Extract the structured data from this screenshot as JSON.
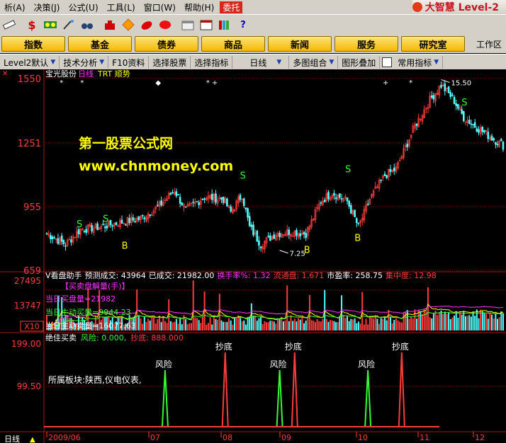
{
  "menu": {
    "items": [
      "析(A)",
      "决策(J)",
      "公式(U)",
      "工具(L)",
      "窗口(W)",
      "帮助(H)"
    ],
    "active": "委托",
    "brand": "大智慧 Level-2"
  },
  "toolbar": {
    "icons": [
      "ruler-icon",
      "dollar-icon",
      "tape-icon",
      "wand-icon",
      "binoculars-icon",
      "alarm-icon",
      "diamond-icon",
      "chili-icon",
      "candy-icon",
      "calendar-icon",
      "window-icon",
      "books-icon",
      "help-icon"
    ]
  },
  "nav": {
    "buttons": [
      "指数",
      "基金",
      "债券",
      "商品",
      "新闻",
      "服务",
      "研究室"
    ],
    "work_area": "工作区"
  },
  "subbar": {
    "items": [
      "Level2默认",
      "技术分析",
      "F10资料",
      "选择股票",
      "选择指标",
      "日线",
      "多图组合",
      "图形叠加",
      "常用指标"
    ],
    "with_arrow": [
      true,
      true,
      false,
      false,
      false,
      true,
      true,
      false,
      true
    ]
  },
  "colors": {
    "up": "#ff3c3c",
    "down": "#54ffff",
    "yellow": "#ffff00",
    "green": "#33ff33",
    "magenta": "#ff33ff",
    "grid": "#800000"
  },
  "main_panel": {
    "stock": "宝光股份",
    "period": "日线",
    "indicator": "TRT 顺势",
    "y_ticks": [
      "1550",
      "1251",
      "955",
      "659"
    ],
    "high_label": "15.50",
    "low_label": "7.25",
    "signals": [
      {
        "t": "S",
        "i": 17,
        "p": 860
      },
      {
        "t": "S",
        "i": 31,
        "p": 885
      },
      {
        "t": "B",
        "i": 41,
        "p": 760
      },
      {
        "t": "S",
        "i": 104,
        "p": 1085
      },
      {
        "t": "B",
        "i": 138,
        "p": 740
      },
      {
        "t": "S",
        "i": 160,
        "p": 1115
      },
      {
        "t": "B",
        "i": 165,
        "p": 795
      },
      {
        "t": "S",
        "i": 222,
        "p": 1425
      }
    ]
  },
  "volume_panel": {
    "title": "V看盘助手",
    "metrics_pred": "预测成交: 43964",
    "metrics_done": "已成交: 21982.00",
    "metrics_turnover": "换手率%: 1.32",
    "metrics_float": "流通盘: 1.671",
    "metrics_pe": "市盈率: 258.75",
    "metrics_conc": "集中度: 12.98",
    "sub_title": "【买卖盘解量(手)】",
    "line1": "当日买盘量=21982",
    "line2": "当日主动买量=9944.23",
    "line3": "当日主动卖量=16077.63",
    "y_ticks": [
      "27495",
      "13747"
    ],
    "unit": "X10"
  },
  "signal_panel": {
    "title": "绝佳买卖",
    "risk_value": "风险: 0.000,",
    "bottom_value": "抄底: 888.000",
    "y_ticks": [
      "199.00",
      "99.50"
    ],
    "sector": "所属板块:陕西,仪电仪表,",
    "risk_label": "风险",
    "bottom_label": "抄底",
    "events": [
      {
        "t": "risk",
        "i": 63
      },
      {
        "t": "bottom",
        "i": 95
      },
      {
        "t": "risk",
        "i": 124
      },
      {
        "t": "bottom",
        "i": 132
      },
      {
        "t": "risk",
        "i": 171
      },
      {
        "t": "bottom",
        "i": 189
      }
    ]
  },
  "x_axis": {
    "labels": [
      "2009/06",
      "07",
      "08",
      "09",
      "10",
      "11",
      "12"
    ]
  },
  "status": {
    "period": "日线"
  },
  "watermark": {
    "line1": "第一股票公式网",
    "line2": "www.chnmoney.com"
  },
  "chart_data": {
    "type": "candlestick",
    "ylim": [
      659,
      1560
    ],
    "waypoints": [
      [
        0,
        830
      ],
      [
        10,
        780
      ],
      [
        18,
        850
      ],
      [
        28,
        860
      ],
      [
        38,
        880
      ],
      [
        50,
        900
      ],
      [
        60,
        960
      ],
      [
        68,
        1030
      ],
      [
        74,
        940
      ],
      [
        84,
        1000
      ],
      [
        94,
        990
      ],
      [
        98,
        930
      ],
      [
        104,
        1010
      ],
      [
        108,
        860
      ],
      [
        114,
        780
      ],
      [
        122,
        830
      ],
      [
        130,
        840
      ],
      [
        138,
        830
      ],
      [
        146,
        980
      ],
      [
        152,
        1020
      ],
      [
        160,
        980
      ],
      [
        166,
        860
      ],
      [
        172,
        990
      ],
      [
        180,
        1100
      ],
      [
        186,
        1130
      ],
      [
        196,
        1330
      ],
      [
        204,
        1450
      ],
      [
        210,
        1520
      ],
      [
        216,
        1460
      ],
      [
        222,
        1370
      ],
      [
        228,
        1330
      ],
      [
        236,
        1280
      ],
      [
        243,
        1240
      ]
    ]
  }
}
